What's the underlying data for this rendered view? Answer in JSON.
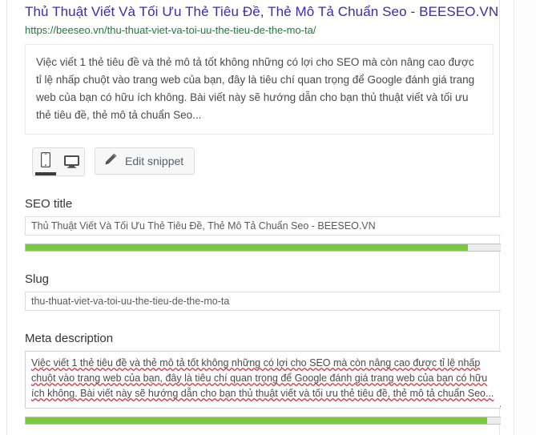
{
  "snippet_preview": {
    "title": "Thủ Thuật Viết Và Tối Ưu Thẻ Tiêu Đề, Thẻ Mô Tả Chuẩn Seo - BEESEO.VN",
    "url": "https://beeseo.vn/thu-thuat-viet-va-toi-uu-the-tieu-de-the-mo-ta/",
    "description": "Việc viết 1 thẻ tiêu đề và thẻ mô tả tốt không những có lợi cho SEO mà còn nâng cao được tỉ lệ nhấp chuột vào trang web của bạn, đây là tiêu chí quan trọng để Google đánh giá trang web của bạn có hữu ích không. Bài viết này sẽ hướng dẫn cho bạn thủ thuật viết và tối ưu thẻ tiêu đề, thẻ mô tả chuẩn Seo..."
  },
  "toolbar": {
    "mobile_icon": "mobile-phone-icon",
    "desktop_icon": "desktop-monitor-icon",
    "active_device": "mobile",
    "edit_snippet_label": "Edit snippet",
    "edit_snippet_icon": "pencil-icon"
  },
  "fields": {
    "seo_title": {
      "label": "SEO title",
      "value": "Thủ Thuật Viết Và Tối Ưu Thẻ Tiêu Đề, Thẻ Mô Tả Chuẩn Seo - BEESEO.VN",
      "placeholder": "",
      "progress_percent": 92,
      "progress_color": "#7ac943"
    },
    "slug": {
      "label": "Slug",
      "value": "thu-thuat-viet-va-toi-uu-the-tieu-de-the-mo-ta",
      "placeholder": ""
    },
    "meta_description": {
      "label": "Meta description",
      "value": "Việc viết 1 thẻ tiêu đề và thẻ mô tả tốt không những có lợi cho SEO mà còn nâng cao được tỉ lệ nhấp chuột vào trang web của bạn, đây là tiêu chí quan trọng để Google đánh giá trang web của bạn có hữu ích không. Bài viết này sẽ hướng dẫn cho bạn thủ thuật viết và tối ưu thẻ tiêu đề, thẻ mô tả chuẩn Seo...",
      "placeholder": "",
      "progress_percent": 96,
      "progress_color": "#7ac943"
    }
  },
  "colors": {
    "title_link": "#3b2ab5",
    "url_green": "#1f7a3d",
    "progress_green": "#7ac943",
    "progress_track": "#ececec",
    "spellcheck_underline": "#e02b2b"
  }
}
